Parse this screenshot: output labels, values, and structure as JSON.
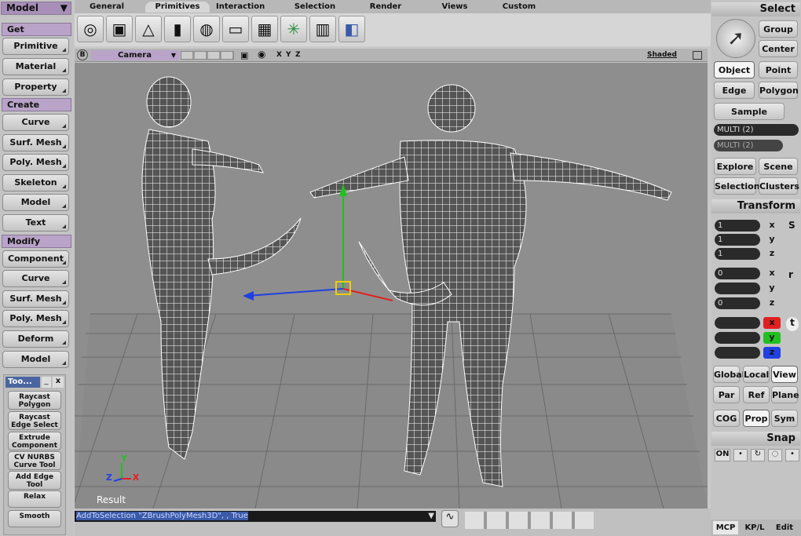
{
  "left": {
    "module": "Model",
    "get_header": "Get",
    "get_items": [
      "Primitive",
      "Material",
      "Property"
    ],
    "create_header": "Create",
    "create_items": [
      "Curve",
      "Surf. Mesh",
      "Poly. Mesh",
      "Skeleton",
      "Model",
      "Text"
    ],
    "modify_header": "Modify",
    "modify_items": [
      "Component",
      "Curve",
      "Surf. Mesh",
      "Poly. Mesh",
      "Deform",
      "Model"
    ],
    "tool_panel_title": "Too...",
    "tool_panel_minimize": "_",
    "tool_panel_close": "x",
    "tool_items": [
      "Raycast Polygon",
      "Raycast Edge Select",
      "Extrude Component",
      "CV NURBS Curve Tool",
      "Add Edge Tool",
      "Relax",
      "Smooth"
    ]
  },
  "tabs": [
    "General",
    "Primitives",
    "Interaction",
    "Selection",
    "Render",
    "Views",
    "Custom"
  ],
  "active_tab": "Primitives",
  "prim_icons": [
    "sphere-icon",
    "cube-icon",
    "cone-icon",
    "cylinder-icon",
    "torus-icon",
    "disc-icon",
    "grid-icon",
    "null-icon",
    "cage-icon",
    "model-icon"
  ],
  "viewport": {
    "letter": "B",
    "camera": "Camera",
    "axes": [
      "X",
      "Y",
      "Z"
    ],
    "mode": "Shaded",
    "label": "Result"
  },
  "command": "AddToSelection \"ZBrushPolyMesh3D\", , True",
  "right": {
    "select_title": "Select",
    "group": "Group",
    "center": "Center",
    "object": "Object",
    "point": "Point",
    "edge": "Edge",
    "polygon": "Polygon",
    "sample": "Sample",
    "multi1": "MULTI (2)",
    "multi2": "MULTI (2)",
    "explore": "Explore",
    "scene": "Scene",
    "selection": "Selection",
    "clusters": "Clusters",
    "transform_title": "Transform",
    "scale": [
      "1",
      "1",
      "1"
    ],
    "rot": [
      "0",
      "",
      "0"
    ],
    "axis_x": "x",
    "axis_y": "y",
    "axis_z": "z",
    "s_letter": "S",
    "r_letter": "r",
    "t_letter": "t",
    "global": "Global",
    "local": "Local",
    "view": "View",
    "par": "Par",
    "ref": "Ref",
    "plane": "Plane",
    "cog": "COG",
    "prop": "Prop",
    "sym": "Sym",
    "snap_title": "Snap",
    "on": "ON",
    "mcp": "MCP",
    "kpl": "KP/L",
    "edit": "Edit"
  },
  "colors": {
    "accent": "#b9a3c8",
    "viewport_bg": "#8e8e8e",
    "x_axis": "#e02020",
    "y_axis": "#20c020",
    "z_axis": "#2040e0"
  }
}
